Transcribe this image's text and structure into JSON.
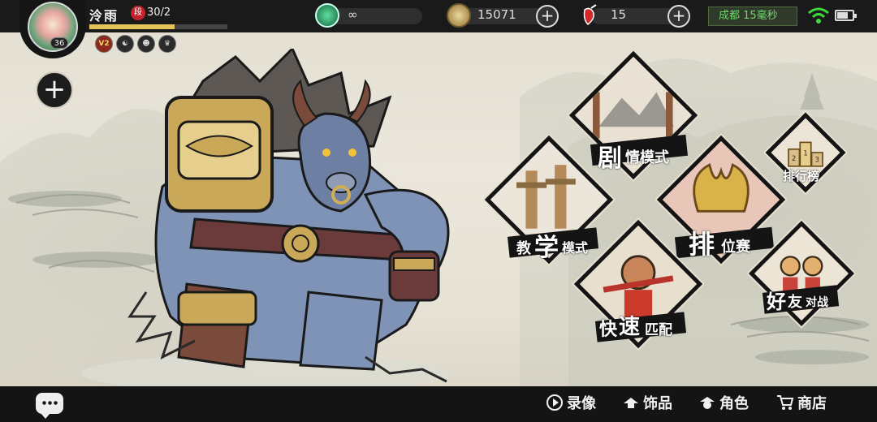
{
  "player": {
    "name": "泠雨",
    "level": "36",
    "rank_glyph": "段",
    "exp_text": "30/2",
    "exp_fraction": 0.62,
    "badges": [
      "V2",
      "",
      "",
      ""
    ]
  },
  "resources": {
    "energy": "∞",
    "coins": "15071",
    "pepper": "15"
  },
  "location": "成都 15毫秒",
  "battery_level": 0.7,
  "modes": {
    "story": {
      "big": "剧",
      "small": "情模式"
    },
    "tutorial": {
      "small1": "教",
      "big": "学",
      "small2": "模式"
    },
    "ranked": {
      "big": "排",
      "small": "位赛"
    },
    "quick": {
      "big1": "快",
      "big2": "速",
      "small": "匹配"
    },
    "leaderboard": {
      "label": "排行榜",
      "pos2": "2",
      "pos1": "1",
      "pos3": "3"
    },
    "friends": {
      "big": "好",
      "small1": "友",
      "small2": "对战"
    }
  },
  "bottom_nav": {
    "replay": "录像",
    "accessories": "饰品",
    "characters": "角色",
    "shop": "商店"
  },
  "colors": {
    "top_bar": "#1a1a1a",
    "location_text": "#6ed86a",
    "exp_fill": "#e3c35a"
  }
}
